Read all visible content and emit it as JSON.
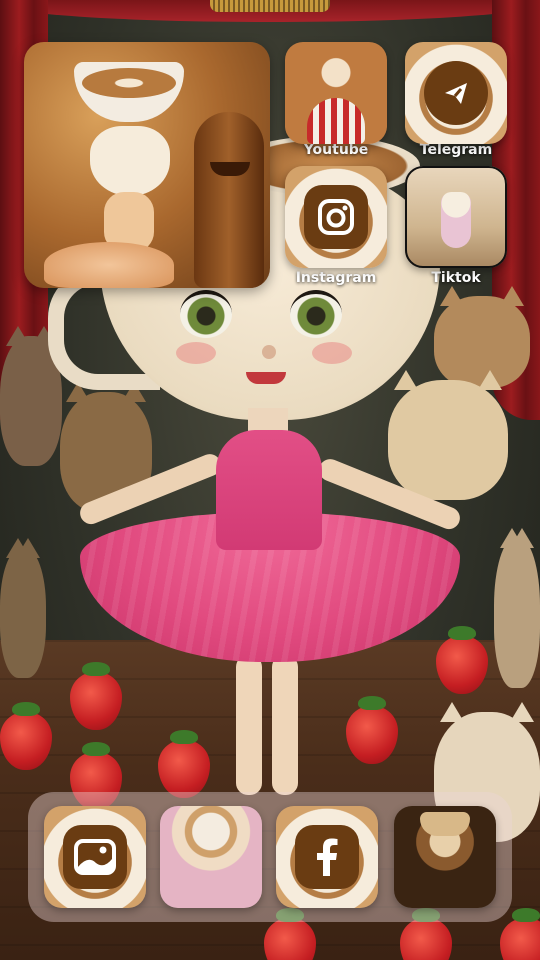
{
  "apps": {
    "youtube": {
      "label": "Youtube",
      "icon": "dancer-photo-icon"
    },
    "telegram": {
      "label": "Telegram",
      "icon": "telegram-icon"
    },
    "instagram": {
      "label": "Instagram",
      "icon": "instagram-icon"
    },
    "tiktok": {
      "label": "Tiktok",
      "icon": "ballerina-photo-icon"
    }
  },
  "dock": {
    "items": [
      {
        "icon": "gallery-icon"
      },
      {
        "icon": "cup-girl-photo-icon"
      },
      {
        "icon": "facebook-icon"
      },
      {
        "icon": "noir-cup-photo-icon"
      }
    ]
  },
  "colors": {
    "icon_badge": "#6a3c12",
    "label_text": "#ffffff",
    "tutu_pink": "#e14a7f",
    "curtain_red": "#9c1c1f"
  }
}
